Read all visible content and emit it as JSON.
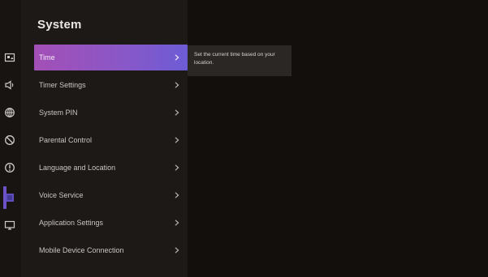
{
  "screen": {
    "title": "System",
    "tooltip": "Set the current time based on your location.",
    "menu": [
      {
        "label": "Time",
        "selected": true
      },
      {
        "label": "Timer Settings",
        "selected": false
      },
      {
        "label": "System PIN",
        "selected": false
      },
      {
        "label": "Parental Control",
        "selected": false
      },
      {
        "label": "Language and Location",
        "selected": false
      },
      {
        "label": "Voice Service",
        "selected": false
      },
      {
        "label": "Application Settings",
        "selected": false
      },
      {
        "label": "Mobile Device Connection",
        "selected": false
      }
    ],
    "rail_icons": [
      "picture-icon",
      "sound-icon",
      "network-icon",
      "accessibility-icon",
      "power-icon",
      "system-icon",
      "support-icon"
    ],
    "colors": {
      "accent_start": "#a34fb6",
      "accent_end": "#6c5cd6",
      "rail_active": "#6e53c8"
    }
  }
}
